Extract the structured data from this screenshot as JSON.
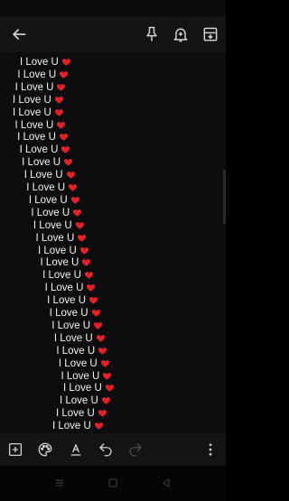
{
  "toolbar_top": {
    "back_icon": "arrow-left-icon",
    "pin_icon": "pin-icon",
    "reminder_icon": "bell-plus-icon",
    "archive_icon": "archive-icon"
  },
  "note": {
    "lines": [
      {
        "text": "I Love U"
      },
      {
        "text": "I Love U"
      },
      {
        "text": "I Love U"
      },
      {
        "text": "I Love U"
      },
      {
        "text": "I Love U"
      },
      {
        "text": "I Love U"
      },
      {
        "text": "I Love U"
      },
      {
        "text": "I Love U"
      },
      {
        "text": "I Love U"
      },
      {
        "text": "I Love U"
      },
      {
        "text": "I Love U"
      },
      {
        "text": "I Love U"
      },
      {
        "text": "I Love U"
      },
      {
        "text": "I Love U"
      },
      {
        "text": "I Love U"
      },
      {
        "text": "I Love U"
      },
      {
        "text": "I Love U"
      },
      {
        "text": "I Love U"
      },
      {
        "text": "I Love U"
      },
      {
        "text": "I Love U"
      },
      {
        "text": "I Love U"
      },
      {
        "text": "I Love U"
      },
      {
        "text": "I Love U"
      },
      {
        "text": "I Love U"
      },
      {
        "text": "I Love U"
      },
      {
        "text": "I Love U"
      },
      {
        "text": "I Love U"
      },
      {
        "text": "I Love U"
      },
      {
        "text": "I Love U"
      },
      {
        "text": "I Love U"
      }
    ],
    "heart_color": "#e0222b"
  },
  "toolbar_bottom": {
    "add_icon": "add-box-icon",
    "palette_icon": "palette-icon",
    "text_format_icon": "text-format-icon",
    "undo_icon": "undo-icon",
    "redo_icon": "redo-icon",
    "more_icon": "more-vert-icon"
  },
  "nav": {
    "menu_icon": "menu-icon",
    "home_icon": "home-icon",
    "back_icon": "back-triangle-icon"
  }
}
